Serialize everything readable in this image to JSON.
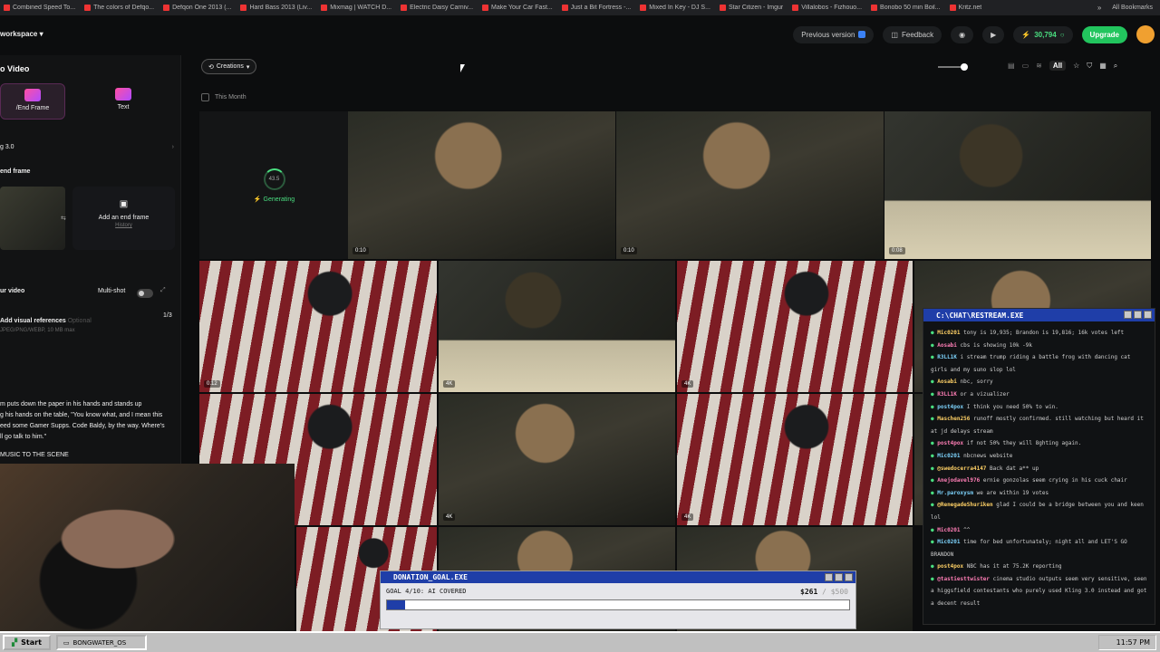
{
  "bookmarks": [
    "Combined Speed To...",
    "The colors of Defqo...",
    "Defqon One 2013 (...",
    "Hard Bass 2013 (Liv...",
    "Mixmag | WATCH D...",
    "Electric Daisy Carniv...",
    "Make Your Car Fast...",
    "Just a Bit Fortress -...",
    "Mixed In Key - DJ S...",
    "Star Citizen - Imgur",
    "Villalobos - Fizhouo...",
    "Bonobo 50 min Boil...",
    "Kritz.net"
  ],
  "bookmarks_all": "All Bookmarks",
  "topbar": {
    "workspace": "workspace",
    "previous_version": "Previous version",
    "feedback": "Feedback",
    "credits": "30,794",
    "upgrade": "Upgrade"
  },
  "sidebar": {
    "title": "o Video",
    "mode_frame": "/End Frame",
    "mode_text": "Text",
    "model": "g 3.0",
    "end_frame_heading": "end frame",
    "add_end_frame": "Add an end frame",
    "history": "History",
    "your_video": "ur video",
    "multishot": "Multi-shot",
    "add_refs": "Add visual references",
    "optional": "Optional",
    "ref_formats": "JPEG/PNG/WEBP, 10 MB max",
    "ref_count": "1/3",
    "prompt_1": "m puts down the paper in his hands and stands up",
    "prompt_2": "g his hands on the table, \"You know what, and I mean this",
    "prompt_3": "eed some Gamer Supps. Code Baldy, by the way. Where's",
    "prompt_4": "ll go talk to him.\"",
    "prompt_5": "MUSIC TO THE SCENE"
  },
  "main": {
    "creations": "Creations",
    "all": "All",
    "this_month": "This Month",
    "progress": "43.5",
    "generating": "Generating"
  },
  "tiles": [
    {
      "badge": "0:10"
    },
    {
      "badge": "0:10"
    },
    {
      "badge": "0:08"
    },
    {
      "badge": "0:12"
    },
    {
      "badge": "4K"
    },
    {
      "badge": "4K"
    },
    {
      "badge": "4K"
    },
    {
      "badge": "4K"
    }
  ],
  "chat": {
    "title": "C:\\CHAT\\RESTREAM.EXE",
    "lines": [
      {
        "user": "Mic0201",
        "text": "tony is 19,935; Brandon is 19,816; 16k votes left"
      },
      {
        "user": "Aosabi",
        "text": "cbs is showing 10k -9k"
      },
      {
        "user": "R3LL1K",
        "text": "i stream trump riding a battle frog with dancing cat girls and my suno slop lol"
      },
      {
        "user": "Aosabi",
        "text": "nbc, sorry"
      },
      {
        "user": "R3LL1K",
        "text": "or a vizualizer"
      },
      {
        "user": "post4pox",
        "text": "I think you need 50% to win."
      },
      {
        "user": "Maschen256",
        "text": "runoff mostly confirmed. still watching but heard it at jd delays stream"
      },
      {
        "user": "post4pox",
        "text": "if not 50% they will 8ghting again."
      },
      {
        "user": "Mic0201",
        "text": "nbcnews website"
      },
      {
        "user": "@swedocerra4147",
        "text": "Back dat a** up"
      },
      {
        "user": "Anejodavel976",
        "text": "ernie gonzolas seem crying in his cuck chair"
      },
      {
        "user": "Mr.paroxysm",
        "text": "we are within 19 votes"
      },
      {
        "user": "@RenegadeShuriken",
        "text": "glad I could be a bridge between you and keen lol"
      },
      {
        "user": "Mic0201",
        "text": "^^"
      },
      {
        "user": "Mic0201",
        "text": "time for bed unfortunately; night all and LET'S GO BRANDON"
      },
      {
        "user": "post4pox",
        "text": "NBC has it at 75.2K reporting"
      },
      {
        "user": "@tastiesttwister",
        "text": "cinema studio outputs seem very sensitive, seen a higgsfield contestants who purely used Kling 3.0 instead and got a decent result"
      }
    ]
  },
  "donation": {
    "title": "DONATION_GOAL.EXE",
    "goal": "GOAL 4/10: AI COVERED",
    "raised": "$261",
    "target": "/ $500",
    "fraction": 0.04
  },
  "taskbar": {
    "start": "Start",
    "task": "BONGWATER_OS",
    "clock": "11:57 PM"
  },
  "colors": {
    "accent_green": "#4ade80",
    "upgrade_green": "#22c55e",
    "retro_blue": "#1f3ea8"
  }
}
